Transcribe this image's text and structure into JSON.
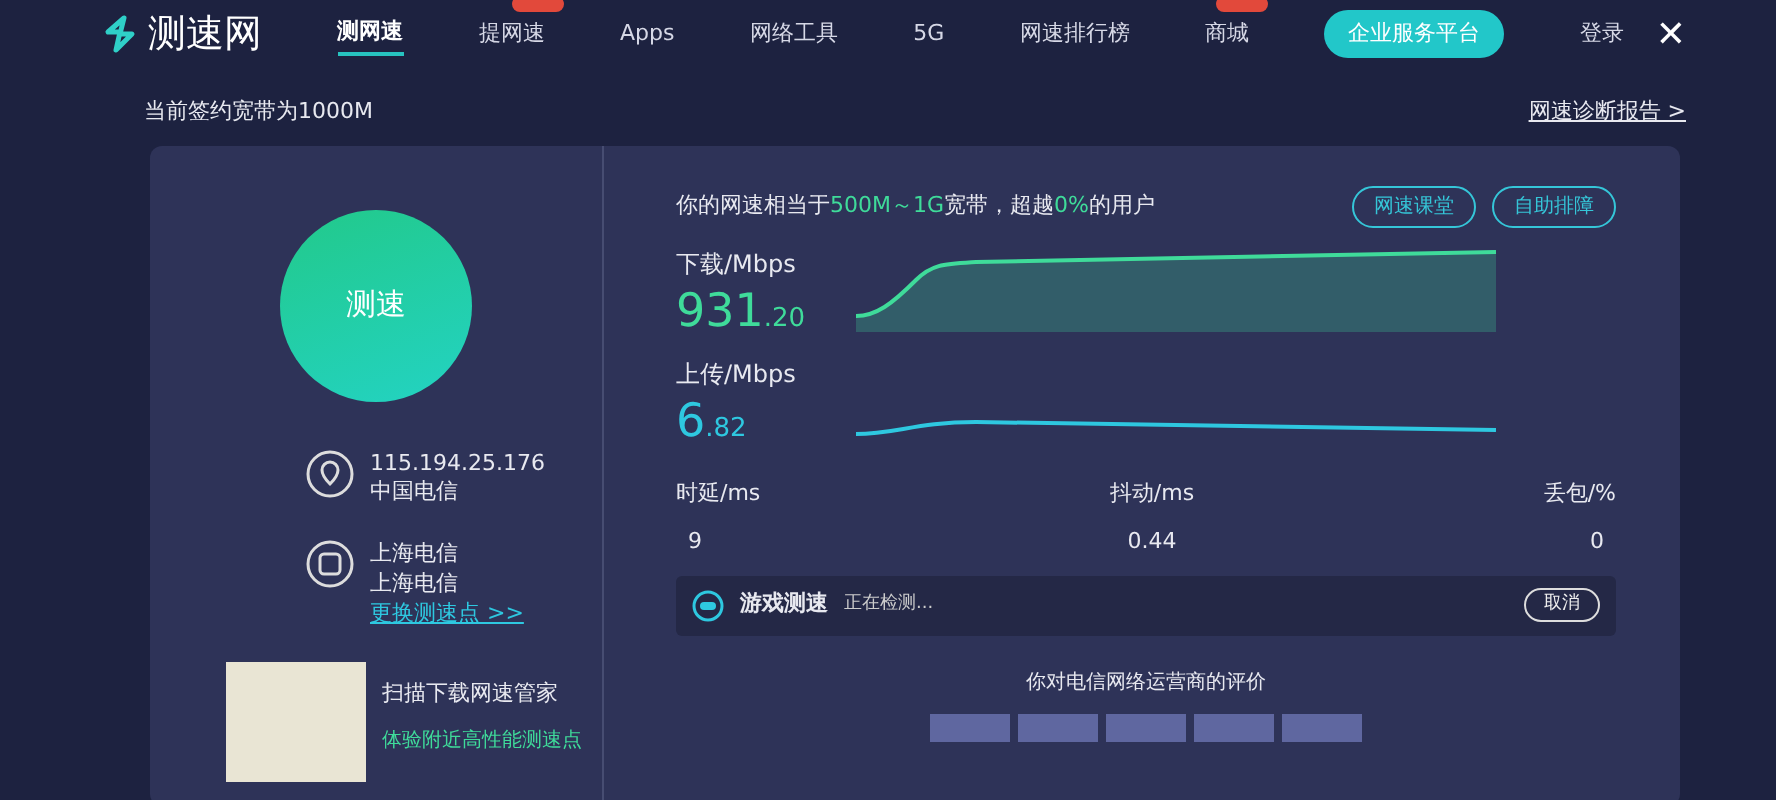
{
  "logo": {
    "text": "测速网"
  },
  "nav": [
    {
      "label": "测网速",
      "selected": true,
      "badge": false
    },
    {
      "label": "提网速",
      "selected": false,
      "badge": true
    },
    {
      "label": "Apps",
      "selected": false,
      "badge": false
    },
    {
      "label": "网络工具",
      "selected": false,
      "badge": false
    },
    {
      "label": "5G",
      "selected": false,
      "badge": false
    },
    {
      "label": "网速排行榜",
      "selected": false,
      "badge": false
    },
    {
      "label": "商城",
      "selected": false,
      "badge": true
    }
  ],
  "enterprise_button": "企业服务平台",
  "login": "登录",
  "close": "✕",
  "bandwidth_note": "当前签约宽带为1000M",
  "report_link": "网速诊断报告 >",
  "start_button": "测速",
  "client": {
    "ip": "115.194.25.176",
    "isp": "中国电信"
  },
  "server": {
    "name": "上海电信",
    "isp": "上海电信",
    "change_link": "更换测速点 >>"
  },
  "app_promo": {
    "line_1": "扫描下载网速管家",
    "line_2": "体验附近高性能测速点"
  },
  "summary": "你的网速相当于**500M～1G**宽带，超越**0%**的用户",
  "buttons": [
    "网速课堂",
    "自助排障"
  ],
  "download": {
    "label": "下载/Mbps",
    "whole": "931",
    "fraction": ".20"
  },
  "upload": {
    "label": "上传/Mbps",
    "whole": "6",
    "fraction": ".82"
  },
  "metrics": [
    {
      "label": "时延/ms",
      "value": "9"
    },
    {
      "label": "抖动/ms",
      "value": "0.44"
    },
    {
      "label": "丢包/%",
      "value": "0"
    }
  ],
  "game_test": {
    "title": "游戏测速",
    "status": "正在检测...",
    "cancel": "取消"
  },
  "rating": {
    "prompt": "你对电信网络运营商的评价"
  }
}
